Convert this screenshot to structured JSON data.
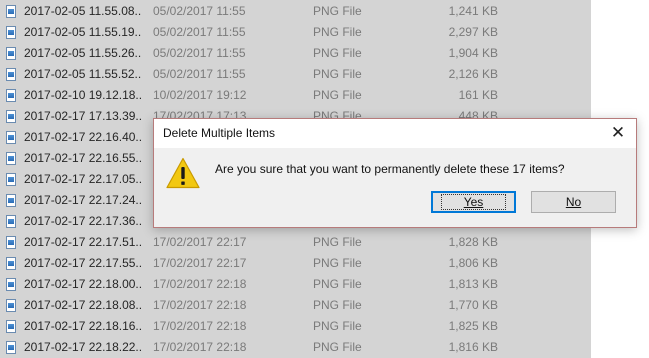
{
  "files": [
    {
      "name": "2017-02-05 11.55.08...",
      "date": "05/02/2017 11:55",
      "type": "PNG File",
      "size": "1,241 KB"
    },
    {
      "name": "2017-02-05 11.55.19...",
      "date": "05/02/2017 11:55",
      "type": "PNG File",
      "size": "2,297 KB"
    },
    {
      "name": "2017-02-05 11.55.26...",
      "date": "05/02/2017 11:55",
      "type": "PNG File",
      "size": "1,904 KB"
    },
    {
      "name": "2017-02-05 11.55.52...",
      "date": "05/02/2017 11:55",
      "type": "PNG File",
      "size": "2,126 KB"
    },
    {
      "name": "2017-02-10 19.12.18...",
      "date": "10/02/2017 19:12",
      "type": "PNG File",
      "size": "161 KB"
    },
    {
      "name": "2017-02-17 17.13.39...",
      "date": "17/02/2017 17:13",
      "type": "PNG File",
      "size": "448 KB"
    },
    {
      "name": "2017-02-17 22.16.40...",
      "date": "",
      "type": "",
      "size": ""
    },
    {
      "name": "2017-02-17 22.16.55...",
      "date": "",
      "type": "",
      "size": ""
    },
    {
      "name": "2017-02-17 22.17.05...",
      "date": "",
      "type": "",
      "size": ""
    },
    {
      "name": "2017-02-17 22.17.24...",
      "date": "",
      "type": "",
      "size": ""
    },
    {
      "name": "2017-02-17 22.17.36...",
      "date": "",
      "type": "",
      "size": ""
    },
    {
      "name": "2017-02-17 22.17.51...",
      "date": "17/02/2017 22:17",
      "type": "PNG File",
      "size": "1,828 KB"
    },
    {
      "name": "2017-02-17 22.17.55...",
      "date": "17/02/2017 22:17",
      "type": "PNG File",
      "size": "1,806 KB"
    },
    {
      "name": "2017-02-17 22.18.00...",
      "date": "17/02/2017 22:18",
      "type": "PNG File",
      "size": "1,813 KB"
    },
    {
      "name": "2017-02-17 22.18.08...",
      "date": "17/02/2017 22:18",
      "type": "PNG File",
      "size": "1,770 KB"
    },
    {
      "name": "2017-02-17 22.18.16...",
      "date": "17/02/2017 22:18",
      "type": "PNG File",
      "size": "1,825 KB"
    },
    {
      "name": "2017-02-17 22.18.22...",
      "date": "17/02/2017 22:18",
      "type": "PNG File",
      "size": "1,816 KB"
    }
  ],
  "file_icon": "png-image-icon",
  "dialog": {
    "title": "Delete Multiple Items",
    "close_icon": "close-icon",
    "warning_icon": "warning-icon",
    "message": "Are you sure that you want to permanently delete these 17 items?",
    "yes_label": "Yes",
    "no_label": "No"
  },
  "colors": {
    "selection": "#d4d4d4",
    "dialog_border": "#b77b7b",
    "default_button_border": "#0078d7",
    "warning_yellow": "#f2c811"
  }
}
